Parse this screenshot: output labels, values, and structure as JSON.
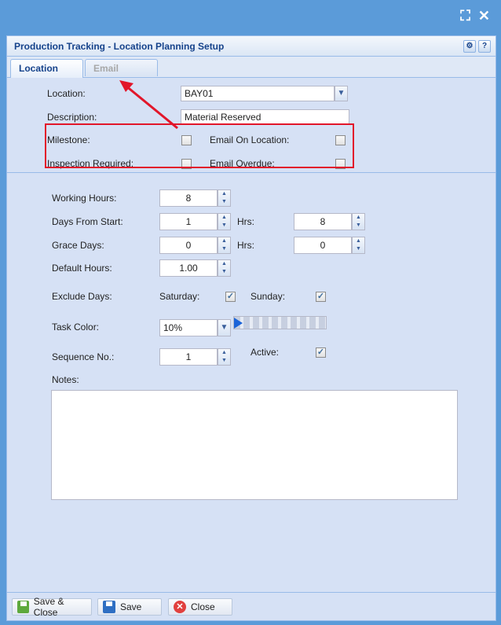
{
  "window": {
    "title": "Production Tracking - Location Planning Setup"
  },
  "tabs": [
    {
      "label": "Location"
    },
    {
      "label": "Email"
    }
  ],
  "form": {
    "location_label": "Location:",
    "location_value": "BAY01",
    "description_label": "Description:",
    "description_value": "Material Reserved",
    "milestone_label": "Milestone:",
    "email_on_location_label": "Email On Location:",
    "inspection_label": "Inspection Required:",
    "email_overdue_label": "Email Overdue:",
    "working_hours_label": "Working Hours:",
    "working_hours_value": "8",
    "days_from_start_label": "Days From Start:",
    "days_from_start_value": "1",
    "hrs_label": "Hrs:",
    "hrs1_value": "8",
    "grace_days_label": "Grace Days:",
    "grace_days_value": "0",
    "hrs2_value": "0",
    "default_hours_label": "Default Hours:",
    "default_hours_value": "1.00",
    "exclude_days_label": "Exclude Days:",
    "saturday_label": "Saturday:",
    "sunday_label": "Sunday:",
    "task_color_label": "Task Color:",
    "task_color_value": "10%",
    "sequence_label": "Sequence No.:",
    "sequence_value": "1",
    "active_label": "Active:",
    "notes_label": "Notes:"
  },
  "footer": {
    "save_close": "Save & Close",
    "save": "Save",
    "close": "Close"
  },
  "colors": {
    "accent": "#15428b",
    "highlight_box": "#e2162a"
  },
  "chart_data": null
}
